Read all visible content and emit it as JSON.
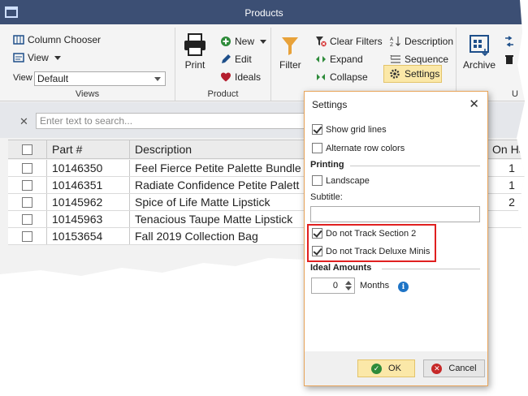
{
  "window": {
    "title": "Products"
  },
  "ribbon": {
    "views": {
      "group_label": "Views",
      "column_chooser": "Column Chooser",
      "view_menu": "View",
      "view_label": "View",
      "view_selected": "Default"
    },
    "product": {
      "group_label": "Product",
      "print": "Print",
      "new": "New",
      "edit": "Edit",
      "ideals": "Ideals"
    },
    "filter": {
      "filter": "Filter",
      "clear_filters": "Clear Filters",
      "expand": "Expand",
      "collapse": "Collapse"
    },
    "sort": {
      "description": "Description",
      "sequence": "Sequence",
      "settings": "Settings"
    },
    "archive": {
      "archive": "Archive",
      "group_label_partial": "U"
    }
  },
  "search": {
    "placeholder": "Enter text to search..."
  },
  "grid": {
    "columns": [
      "Part #",
      "Description",
      "On Ha"
    ],
    "rows": [
      {
        "part": "10146350",
        "description": "Feel Fierce Petite Palette Bundle",
        "on_hand": "1"
      },
      {
        "part": "10146351",
        "description": "Radiate Confidence Petite Palett",
        "on_hand": "1"
      },
      {
        "part": "10145962",
        "description": "Spice of Life Matte Lipstick",
        "on_hand": "2"
      },
      {
        "part": "10145963",
        "description": "Tenacious Taupe Matte Lipstick",
        "on_hand": ""
      },
      {
        "part": "10153654",
        "description": "Fall 2019 Collection Bag",
        "on_hand": ""
      }
    ]
  },
  "dialog": {
    "title": "Settings",
    "show_grid_lines": {
      "label": "Show grid lines",
      "checked": true
    },
    "alternate_row_colors": {
      "label": "Alternate row colors",
      "checked": false
    },
    "printing_header": "Printing",
    "landscape": {
      "label": "Landscape",
      "checked": false
    },
    "subtitle_label": "Subtitle:",
    "subtitle_value": "",
    "track_section2": {
      "label": "Do not Track Section 2",
      "checked": true
    },
    "track_deluxe": {
      "label": "Do not Track Deluxe Minis",
      "checked": true
    },
    "ideal_header": "Ideal Amounts",
    "months_value": "0",
    "months_label": "Months",
    "ok": "OK",
    "cancel": "Cancel"
  },
  "colors": {
    "titlebar": "#3c4f74",
    "accent_highlight": "#fbe8a8",
    "annotation_red": "#e02020"
  }
}
